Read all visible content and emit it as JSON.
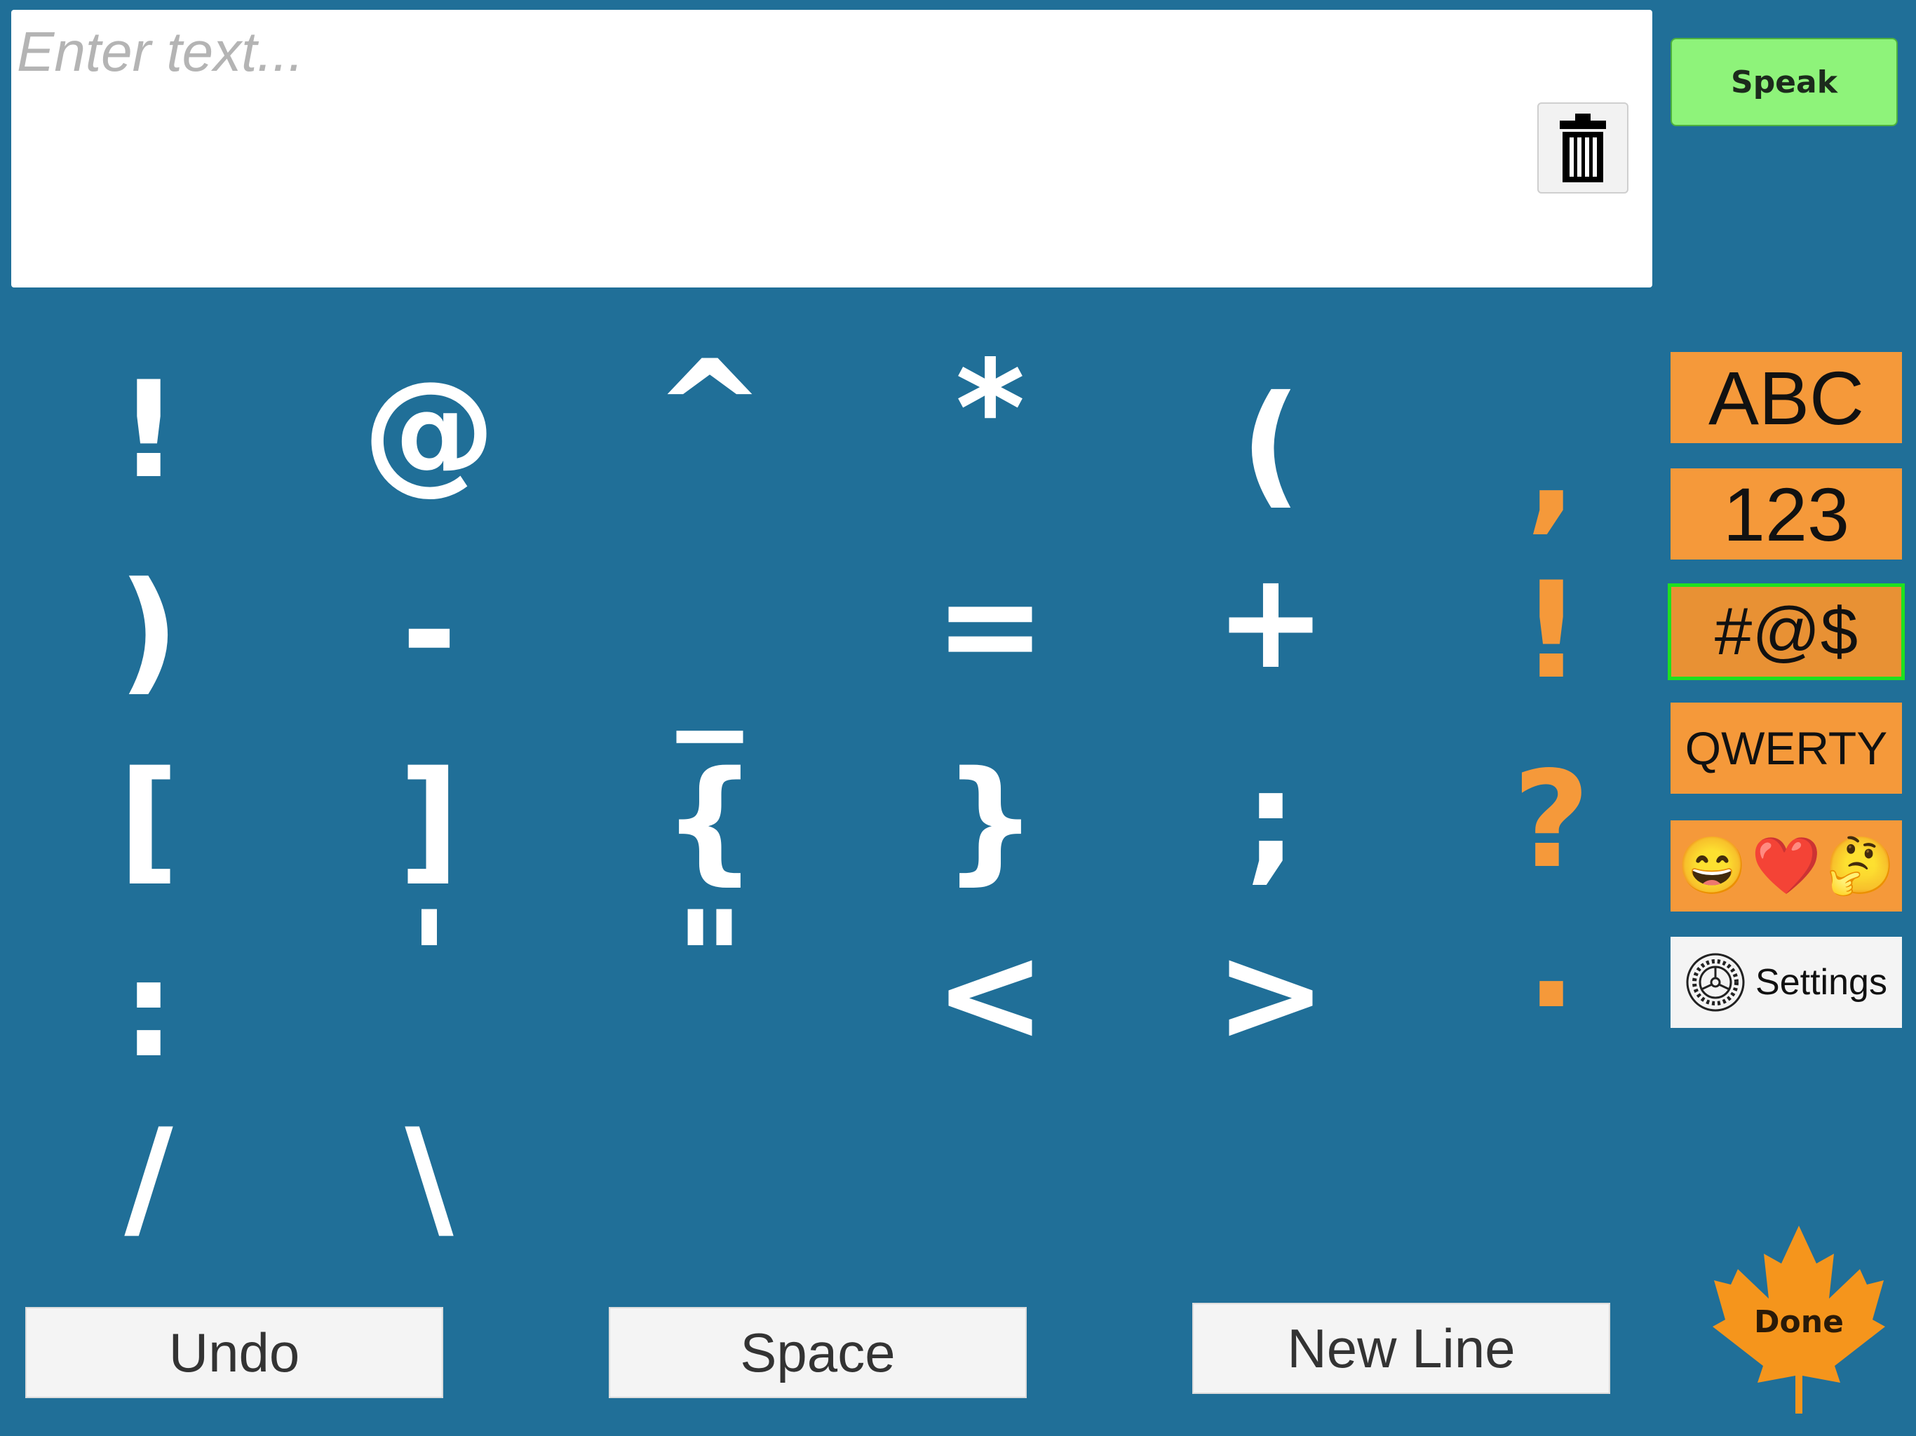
{
  "input": {
    "placeholder": "Enter text..."
  },
  "trash": {
    "icon": "trash-icon"
  },
  "speak": {
    "label": "Speak"
  },
  "symbols": {
    "row1": [
      "!",
      "@",
      "^",
      "*",
      "("
    ],
    "row2": [
      ")",
      "-",
      "_",
      "=",
      "+"
    ],
    "row3": [
      "[",
      "]",
      "{",
      "}",
      ";"
    ],
    "row4": [
      ":",
      "'",
      "\"",
      "<",
      ">"
    ],
    "row5": [
      "/",
      "\\"
    ],
    "punctuation": [
      ",",
      "!",
      "?",
      "."
    ]
  },
  "sidebar": {
    "abc": "ABC",
    "numbers": "123",
    "symbols": "#@$",
    "qwerty": "QWERTY",
    "emoji": [
      "😄",
      "❤️",
      "🤔"
    ],
    "settings": "Settings"
  },
  "bottom": {
    "undo": "Undo",
    "space": "Space",
    "newline": "New Line",
    "done": "Done"
  },
  "colors": {
    "background": "#206f98",
    "accent": "#f5993a",
    "speak": "#8ef37a",
    "selected_border": "#1fe01f"
  }
}
